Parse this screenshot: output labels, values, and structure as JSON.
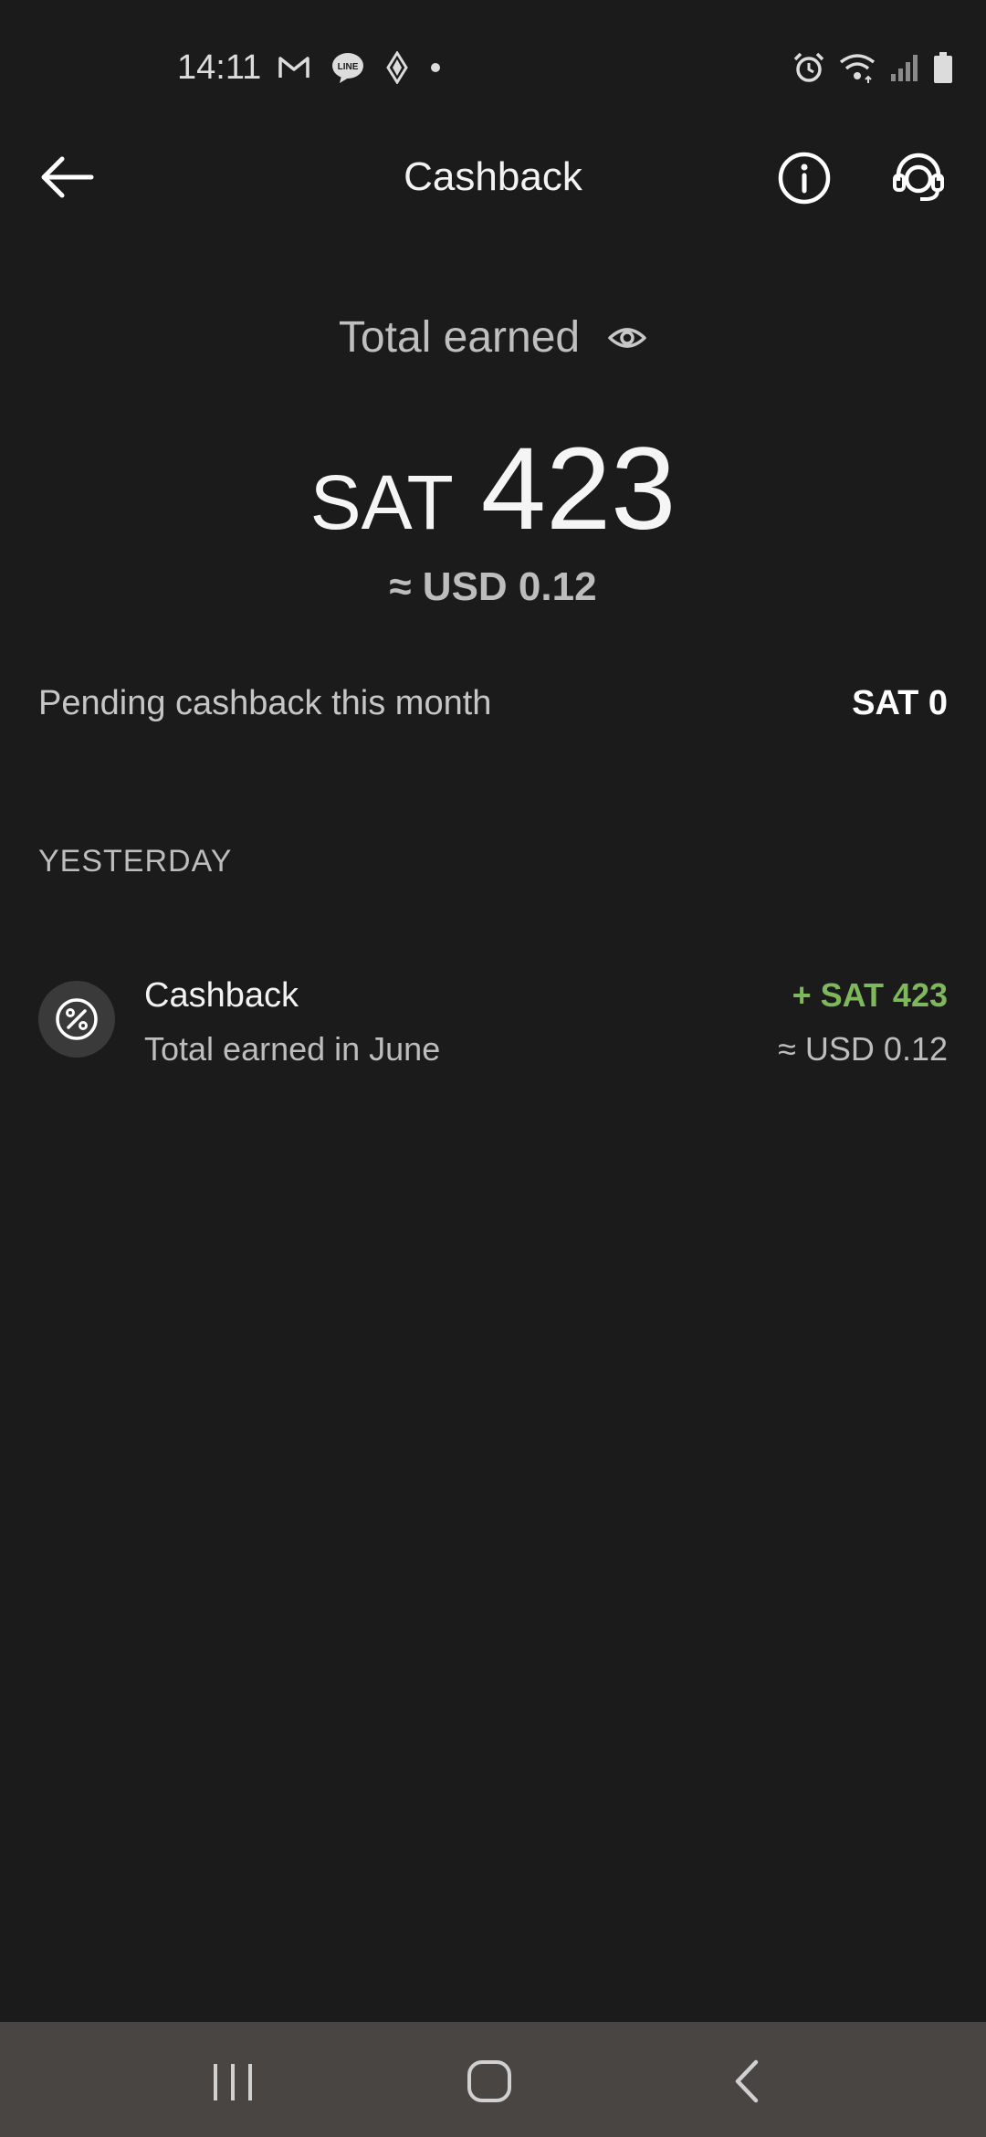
{
  "status_bar": {
    "time": "14:11",
    "left_icons": [
      "gmail-icon",
      "line-icon",
      "app-diamond-icon",
      "notification-dot-icon"
    ],
    "right_icons": [
      "alarm-icon",
      "wifi-icon",
      "signal-icon",
      "battery-icon"
    ]
  },
  "header": {
    "title": "Cashback",
    "back_icon": "arrow-left-icon",
    "info_icon": "info-icon",
    "support_icon": "headset-icon"
  },
  "summary": {
    "label": "Total earned",
    "amount_unit": "SAT",
    "amount_value": "423",
    "usd_approx": "≈ USD 0.12"
  },
  "pending": {
    "label": "Pending cashback this month",
    "value": "SAT 0"
  },
  "history": {
    "section_label": "YESTERDAY",
    "items": [
      {
        "icon": "percent-icon",
        "title": "Cashback",
        "subtitle": "Total earned in June",
        "amount": "+ SAT 423",
        "fiat": "≈ USD 0.12"
      }
    ]
  },
  "colors": {
    "background": "#1b1b1b",
    "positive": "#7fb85c",
    "nav_bar": "#484543"
  }
}
